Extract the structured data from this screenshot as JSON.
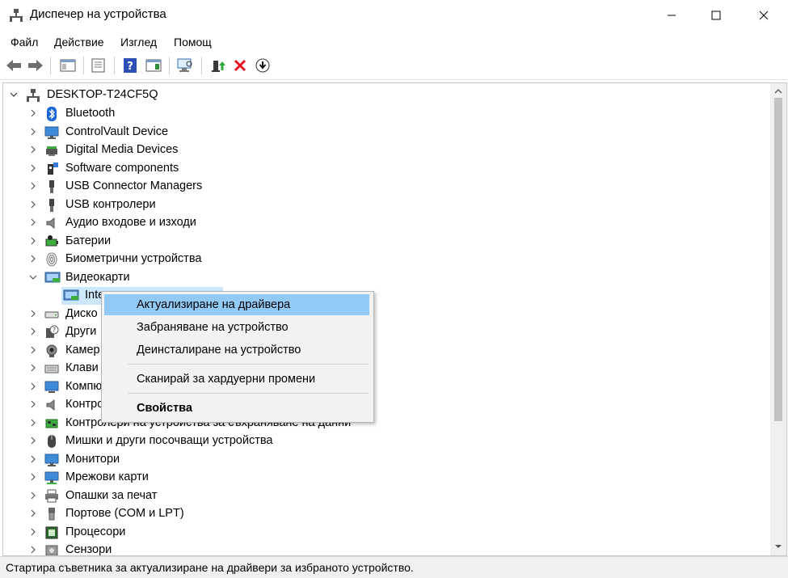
{
  "window": {
    "title": "Диспечер на устройства",
    "icon": "device-manager-icon"
  },
  "menubar": {
    "items": [
      "Файл",
      "Действие",
      "Изглед",
      "Помощ"
    ]
  },
  "toolbar": {
    "buttons": [
      "back-icon",
      "forward-icon",
      "show-hide-console-tree-icon",
      "properties-icon",
      "help-icon",
      "action-pane-icon",
      "scan-hardware-icon",
      "update-driver-icon",
      "uninstall-icon",
      "disable-device-icon"
    ]
  },
  "tree": {
    "root": "DESKTOP-T24CF5Q",
    "items": [
      {
        "label": "Bluetooth",
        "icon": "bluetooth-icon"
      },
      {
        "label": "ControlVault Device",
        "icon": "monitor-icon"
      },
      {
        "label": "Digital Media Devices",
        "icon": "media-device-icon"
      },
      {
        "label": "Software components",
        "icon": "software-component-icon"
      },
      {
        "label": "USB Connector Managers",
        "icon": "usb-icon"
      },
      {
        "label": "USB контролери",
        "icon": "usb-icon"
      },
      {
        "label": "Аудио входове и изходи",
        "icon": "speaker-icon"
      },
      {
        "label": "Батерии",
        "icon": "battery-icon"
      },
      {
        "label": "Биометрични устройства",
        "icon": "fingerprint-icon"
      },
      {
        "label": "Видеокарти",
        "icon": "display-adapter-icon"
      },
      {
        "label": "Inte",
        "icon": "display-adapter-icon"
      },
      {
        "label": "Диско",
        "icon": "disk-icon"
      },
      {
        "label": "Други",
        "icon": "unknown-device-icon"
      },
      {
        "label": "Камер",
        "icon": "camera-icon"
      },
      {
        "label": "Клави",
        "icon": "keyboard-icon"
      },
      {
        "label": "Компю",
        "icon": "computer-icon"
      },
      {
        "label": "Контро",
        "icon": "speaker-icon"
      },
      {
        "label": "Контролери на устройства за съхраняване на данни",
        "icon": "storage-controller-icon"
      },
      {
        "label": "Мишки и други посочващи устройства",
        "icon": "mouse-icon"
      },
      {
        "label": "Монитори",
        "icon": "monitor-icon"
      },
      {
        "label": "Мрежови карти",
        "icon": "network-adapter-icon"
      },
      {
        "label": "Опашки за печат",
        "icon": "printer-icon"
      },
      {
        "label": "Портове (COM и LPT)",
        "icon": "port-icon"
      },
      {
        "label": "Процесори",
        "icon": "processor-icon"
      },
      {
        "label": "Сензори",
        "icon": "sensor-icon"
      }
    ]
  },
  "context_menu": {
    "items": [
      {
        "label": "Актуализиране на драйвера",
        "highlighted": true
      },
      {
        "label": "Забраняване на устройство"
      },
      {
        "label": "Деинсталиране на устройство"
      },
      {
        "label": "Сканирай за хардуерни промени"
      },
      {
        "label": "Свойства",
        "bold": true
      }
    ]
  },
  "statusbar": {
    "text": "Стартира съветника за актуализиране на драйвери за избраното устройство."
  },
  "colors": {
    "highlight": "#91c9f7",
    "selection": "#cce8ff",
    "accent_red": "#e81123"
  }
}
